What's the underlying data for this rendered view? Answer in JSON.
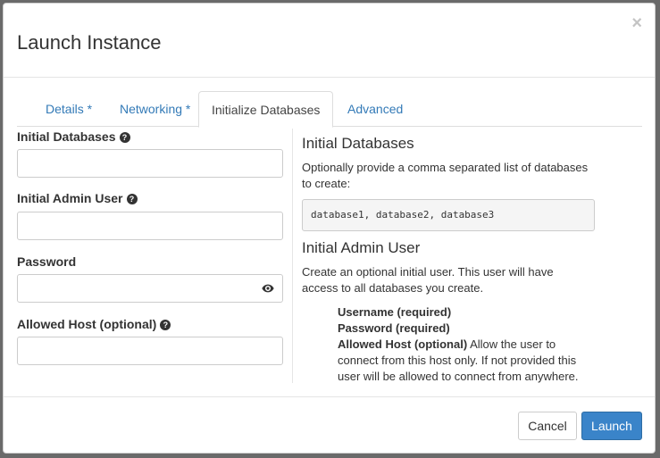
{
  "dialog": {
    "title": "Launch Instance",
    "close_glyph": "×"
  },
  "tabs": [
    {
      "label": "Details *",
      "active": false
    },
    {
      "label": "Networking *",
      "active": false
    },
    {
      "label": "Initialize Databases",
      "active": true
    },
    {
      "label": "Advanced",
      "active": false
    }
  ],
  "form": {
    "initial_databases": {
      "label": "Initial Databases",
      "value": "",
      "placeholder": "",
      "help_icon": "question-circle-icon"
    },
    "initial_admin_user": {
      "label": "Initial Admin User",
      "value": "",
      "placeholder": "",
      "help_icon": "question-circle-icon"
    },
    "password": {
      "label": "Password",
      "value": "",
      "placeholder": "",
      "toggle_icon": "eye-icon"
    },
    "allowed_host": {
      "label": "Allowed Host (optional)",
      "value": "",
      "placeholder": "",
      "help_icon": "question-circle-icon"
    }
  },
  "help": {
    "databases_heading": "Initial Databases",
    "databases_text": "Optionally provide a comma separated list of databases to create:",
    "databases_example": "database1, database2, database3",
    "admin_heading": "Initial Admin User",
    "admin_text": "Create an optional initial user. This user will have access to all databases you create.",
    "username_term": "Username (required)",
    "password_term": "Password (required)",
    "allowed_host_term": "Allowed Host (optional)",
    "allowed_host_desc": "Allow the user to connect from this host only. If not provided this user will be allowed to connect from anywhere."
  },
  "footer": {
    "cancel_label": "Cancel",
    "launch_label": "Launch"
  },
  "colors": {
    "link": "#337ab7",
    "primary": "#3a84c9",
    "border": "#cccccc"
  }
}
